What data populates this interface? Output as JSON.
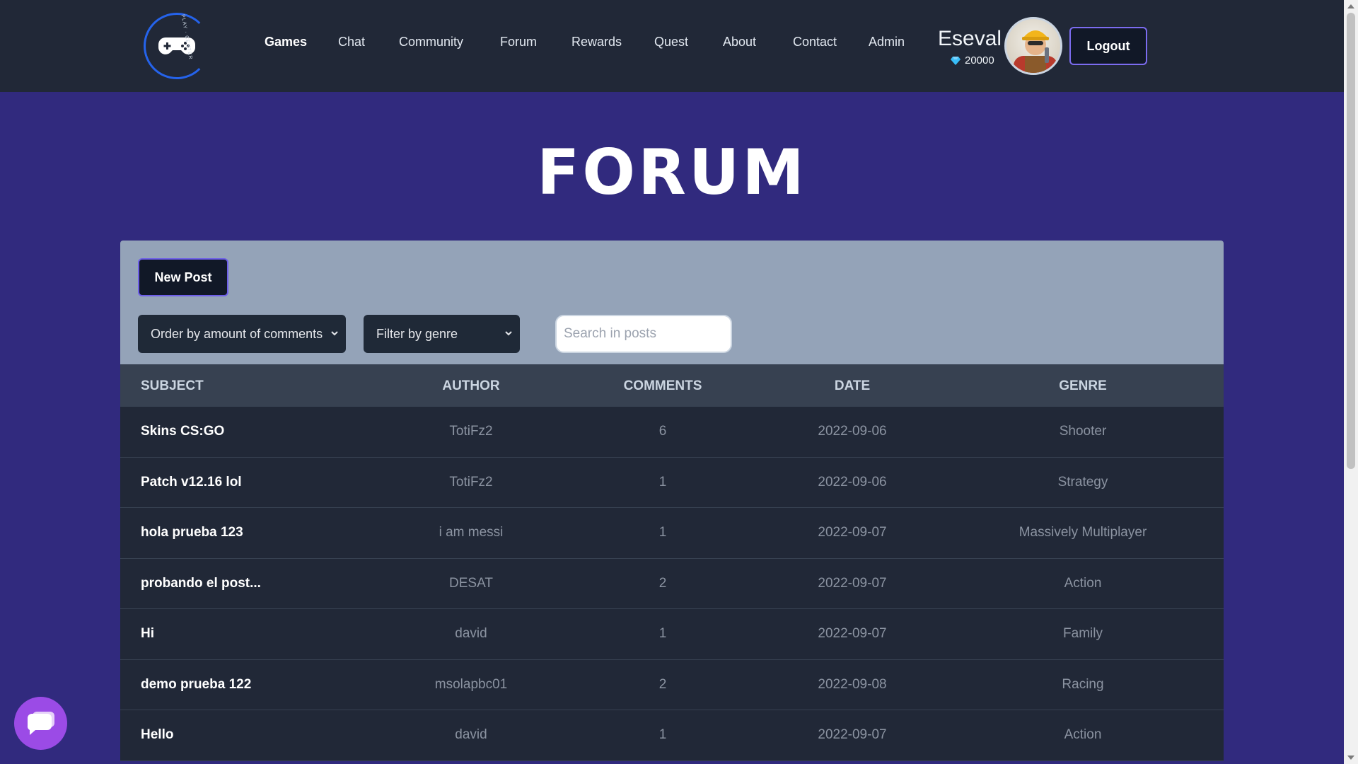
{
  "nav": {
    "logo_icon": "gamepad-icon",
    "logo_text": "PLAY · CENTER",
    "links": [
      {
        "label": "Games",
        "active": true
      },
      {
        "label": "Chat"
      },
      {
        "label": "Community"
      },
      {
        "label": "Forum"
      },
      {
        "label": "Rewards"
      },
      {
        "label": "Quest"
      },
      {
        "label": "About"
      },
      {
        "label": "Contact"
      },
      {
        "label": "Admin"
      }
    ],
    "user": {
      "name": "Eseval",
      "gems": "20000",
      "gem_icon": "diamond-icon"
    },
    "logout_label": "Logout"
  },
  "page": {
    "title": "FORUM"
  },
  "controls": {
    "new_post_label": "New Post",
    "order_select": "Order by amount of comments",
    "genre_select": "Filter by genre",
    "search_placeholder": "Search in posts"
  },
  "table": {
    "headers": {
      "subject": "SUBJECT",
      "author": "AUTHOR",
      "comments": "COMMENTS",
      "date": "DATE",
      "genre": "GENRE"
    },
    "rows": [
      {
        "subject": "Skins CS:GO",
        "author": "TotiFz2",
        "comments": "6",
        "date": "2022-09-06",
        "genre": "Shooter"
      },
      {
        "subject": "Patch v12.16 lol",
        "author": "TotiFz2",
        "comments": "1",
        "date": "2022-09-06",
        "genre": "Strategy"
      },
      {
        "subject": "hola prueba 123",
        "author": "i am messi",
        "comments": "1",
        "date": "2022-09-07",
        "genre": "Massively Multiplayer"
      },
      {
        "subject": "probando el post...",
        "author": "DESAT",
        "comments": "2",
        "date": "2022-09-07",
        "genre": "Action"
      },
      {
        "subject": "Hi",
        "author": "david",
        "comments": "1",
        "date": "2022-09-07",
        "genre": "Family"
      },
      {
        "subject": "demo prueba 122",
        "author": "msolapbc01",
        "comments": "2",
        "date": "2022-09-08",
        "genre": "Racing"
      },
      {
        "subject": "Hello",
        "author": "david",
        "comments": "1",
        "date": "2022-09-07",
        "genre": "Action"
      }
    ]
  },
  "chat_fab": {
    "icon": "chat-bubble-icon"
  },
  "colors": {
    "navbar": "#212837",
    "background": "#312a7e",
    "controls_panel": "#94a3b8",
    "table_header": "#374151",
    "table_row": "#212837",
    "accent": "#7c6cf0",
    "chat_fab": "#9b4be6"
  }
}
